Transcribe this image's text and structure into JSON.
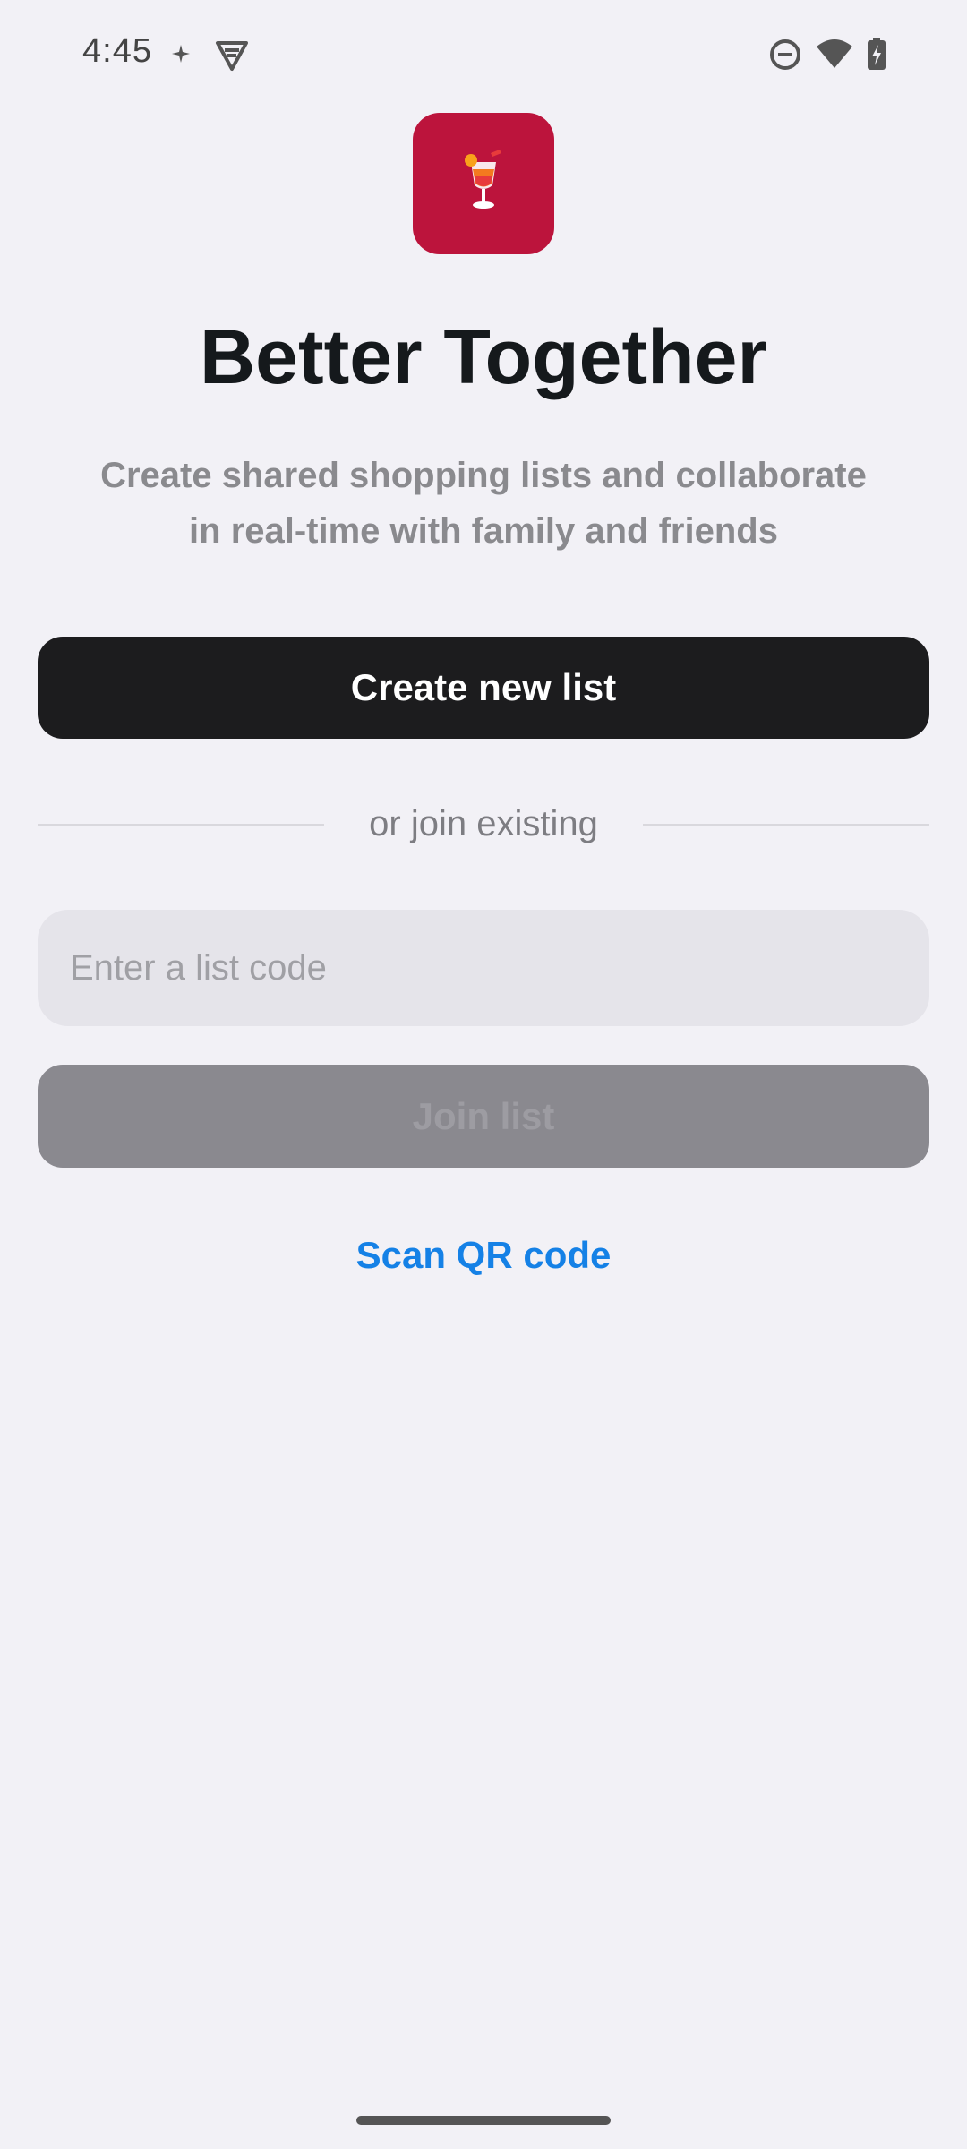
{
  "status_bar": {
    "time": "4:45",
    "left_icons": [
      "sparkle-icon",
      "vpn-shield-icon"
    ],
    "right_icons": [
      "do-not-disturb-icon",
      "wifi-icon",
      "battery-charging-icon"
    ]
  },
  "app": {
    "icon": "tropical-drink-icon",
    "icon_bg_color": "#bc143c",
    "title": "Better Together",
    "subtitle_line1": "Create shared shopping lists and collaborate",
    "subtitle_line2": "in real-time with family and friends"
  },
  "actions": {
    "create_label": "Create new list",
    "divider_text": "or join existing",
    "code_placeholder": "Enter a list code",
    "code_value": "",
    "join_label": "Join list",
    "join_enabled": false,
    "scan_label": "Scan QR code"
  },
  "colors": {
    "background": "#f2f1f6",
    "primary_button": "#1c1c1e",
    "disabled_button": "#8a898f",
    "link": "#1581e6"
  }
}
